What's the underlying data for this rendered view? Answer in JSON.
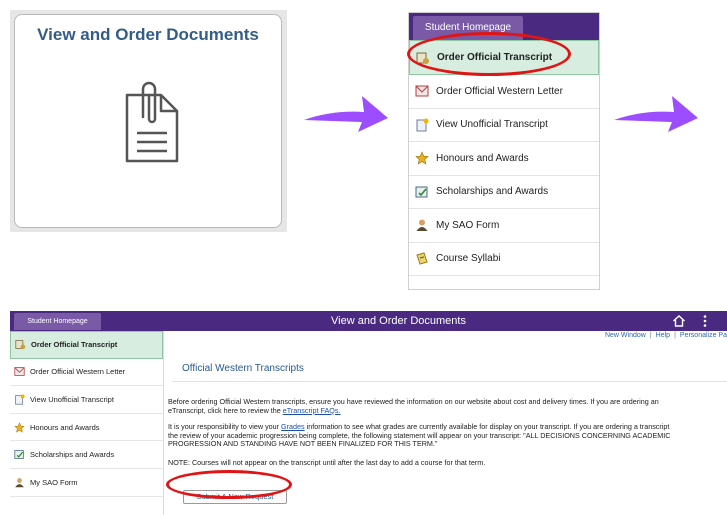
{
  "tile": {
    "title": "View and Order Documents",
    "icon": "document-clip-icon"
  },
  "arrows": {
    "color": "#9b4dff"
  },
  "menu_small": {
    "tab": "Student Homepage",
    "items": [
      {
        "label": "Order Official Transcript",
        "icon": "transcript-stamp-icon",
        "active": true
      },
      {
        "label": "Order Official Western Letter",
        "icon": "letter-icon"
      },
      {
        "label": "View Unofficial Transcript",
        "icon": "doc-star-icon"
      },
      {
        "label": "Honours and Awards",
        "icon": "star-icon"
      },
      {
        "label": "Scholarships and Awards",
        "icon": "certificate-icon"
      },
      {
        "label": "My SAO Form",
        "icon": "person-icon"
      },
      {
        "label": "Course Syllabi",
        "icon": "syllabus-icon"
      }
    ]
  },
  "page": {
    "tab": "Student Homepage",
    "title": "View and Order Documents",
    "header_icons": [
      "home-icon",
      "kebab-menu-icon"
    ],
    "links": [
      "New Window",
      "Help",
      "Personalize Pa"
    ],
    "sidebar": [
      {
        "label": "Order Official Transcript",
        "active": true
      },
      {
        "label": "Order Official Western Letter"
      },
      {
        "label": "View Unofficial Transcript"
      },
      {
        "label": "Honours and Awards"
      },
      {
        "label": "Scholarships and Awards"
      },
      {
        "label": "My SAO Form"
      }
    ],
    "heading": "Official Western Transcripts",
    "para1_a": "Before ordering Official Western transcripts, ensure you have reviewed the information on our website about cost and delivery times. If you are ordering an",
    "para1_b_pre": "eTranscript, click here to review the ",
    "para1_b_link": "eTranscript FAQs.",
    "para2_a_pre": "It is your responsibility to view your ",
    "para2_a_link": "Grades",
    "para2_a_post": " information to see what grades are currently available for display on your transcript. If you are ordering a transcript",
    "para2_b": "the review of your academic progression being complete, the following statement will appear on your transcript: \"ALL DECISIONS CONCERNING ACADEMIC",
    "para2_c": "PROGRESSION AND STANDING HAVE NOT BEEN FINALIZED FOR THIS TERM.\"",
    "note": "NOTE: Courses will not appear on the transcript until after the last day to add a course for that term.",
    "submit": "Submit A New Request"
  }
}
